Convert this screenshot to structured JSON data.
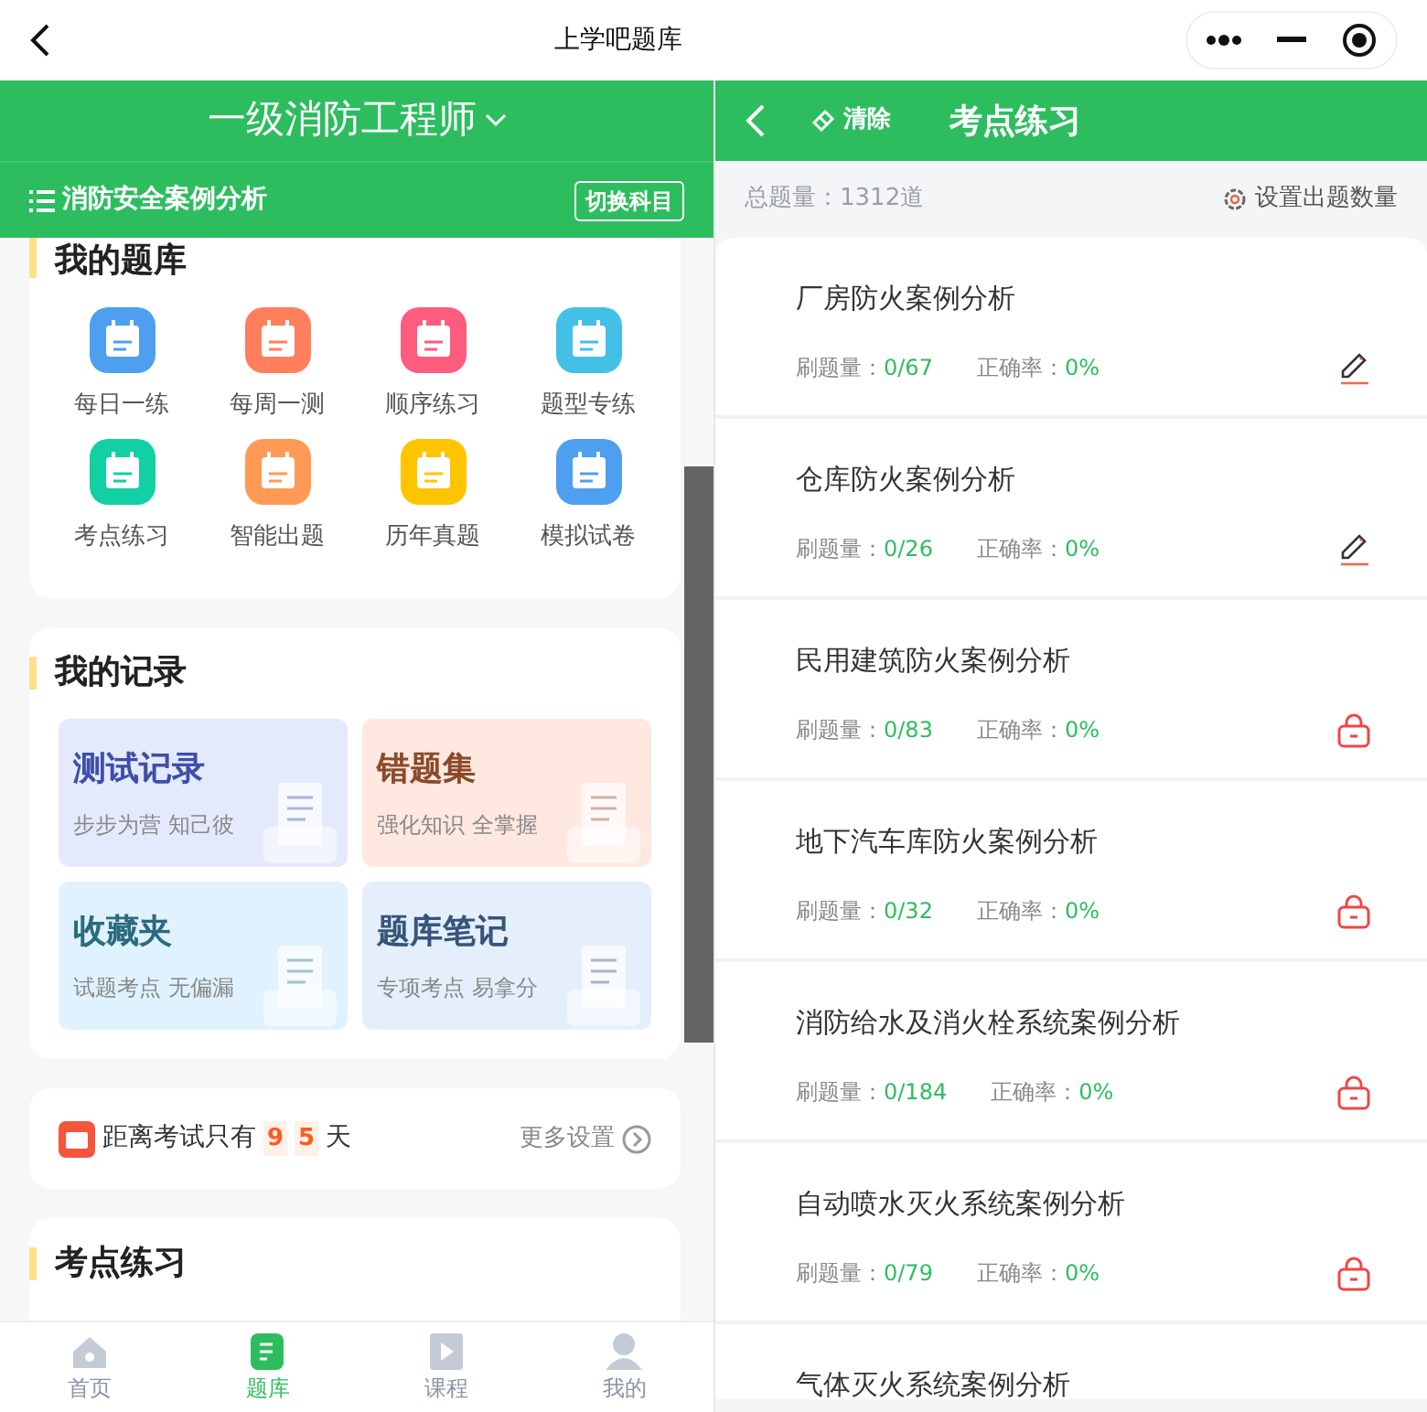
{
  "top_bar": {
    "title": "上学吧题库"
  },
  "left": {
    "exam": {
      "title": "一级消防工程师"
    },
    "subject": {
      "name": "消防安全案例分析",
      "switch_button": "切换科目"
    },
    "question_bank": {
      "heading": "我的题库",
      "items": [
        {
          "label": "每日一练",
          "color": "#4e9ff0"
        },
        {
          "label": "每周一测",
          "color": "#ff7f5c"
        },
        {
          "label": "顺序练习",
          "color": "#fd5c7e"
        },
        {
          "label": "题型专练",
          "color": "#44c0e6"
        },
        {
          "label": "考点练习",
          "color": "#12cfa4"
        },
        {
          "label": "智能出题",
          "color": "#ff9a55"
        },
        {
          "label": "历年真题",
          "color": "#ffc400"
        },
        {
          "label": "模拟试卷",
          "color": "#4e9ff0"
        }
      ]
    },
    "records": {
      "heading": "我的记录",
      "tiles": [
        {
          "title": "测试记录",
          "subtitle": "步步为营 知己彼",
          "color": "#e4e9fd"
        },
        {
          "title": "错题集",
          "subtitle": "强化知识 全掌握",
          "color": "#ffe8e0"
        },
        {
          "title": "收藏夹",
          "subtitle": "试题考点 无偏漏",
          "color": "#dff2fd"
        },
        {
          "title": "题库笔记",
          "subtitle": "专项考点 易拿分",
          "color": "#e5effc"
        }
      ]
    },
    "countdown": {
      "prefix": "距离考试只有",
      "digits": [
        "9",
        "5"
      ],
      "suffix": "天",
      "link": "更多设置"
    },
    "practice": {
      "heading": "考点练习"
    }
  },
  "right": {
    "header": {
      "clear": "清除",
      "title": "考点练习"
    },
    "summary": {
      "total": "总题量：1312道",
      "settings": "设置出题数量"
    },
    "chapters": [
      {
        "name": "厂房防火案例分析",
        "done_label": "刷题量：",
        "done": "0/67",
        "accuracy_label": "正确率：",
        "accuracy": "0%",
        "locked": false
      },
      {
        "name": "仓库防火案例分析",
        "done_label": "刷题量：",
        "done": "0/26",
        "accuracy_label": "正确率：",
        "accuracy": "0%",
        "locked": false
      },
      {
        "name": "民用建筑防火案例分析",
        "done_label": "刷题量：",
        "done": "0/83",
        "accuracy_label": "正确率：",
        "accuracy": "0%",
        "locked": true
      },
      {
        "name": "地下汽车库防火案例分析",
        "done_label": "刷题量：",
        "done": "0/32",
        "accuracy_label": "正确率：",
        "accuracy": "0%",
        "locked": true
      },
      {
        "name": "消防给水及消火栓系统案例分析",
        "done_label": "刷题量：",
        "done": "0/184",
        "accuracy_label": "正确率：",
        "accuracy": "0%",
        "locked": true
      },
      {
        "name": "自动喷水灭火系统案例分析",
        "done_label": "刷题量：",
        "done": "0/79",
        "accuracy_label": "正确率：",
        "accuracy": "0%",
        "locked": true
      },
      {
        "name": "气体灭火系统案例分析"
      }
    ]
  },
  "bottom_nav": [
    {
      "label": "首页",
      "selected": false
    },
    {
      "label": "题库",
      "selected": true
    },
    {
      "label": "课程",
      "selected": false
    },
    {
      "label": "我的",
      "selected": false
    }
  ]
}
